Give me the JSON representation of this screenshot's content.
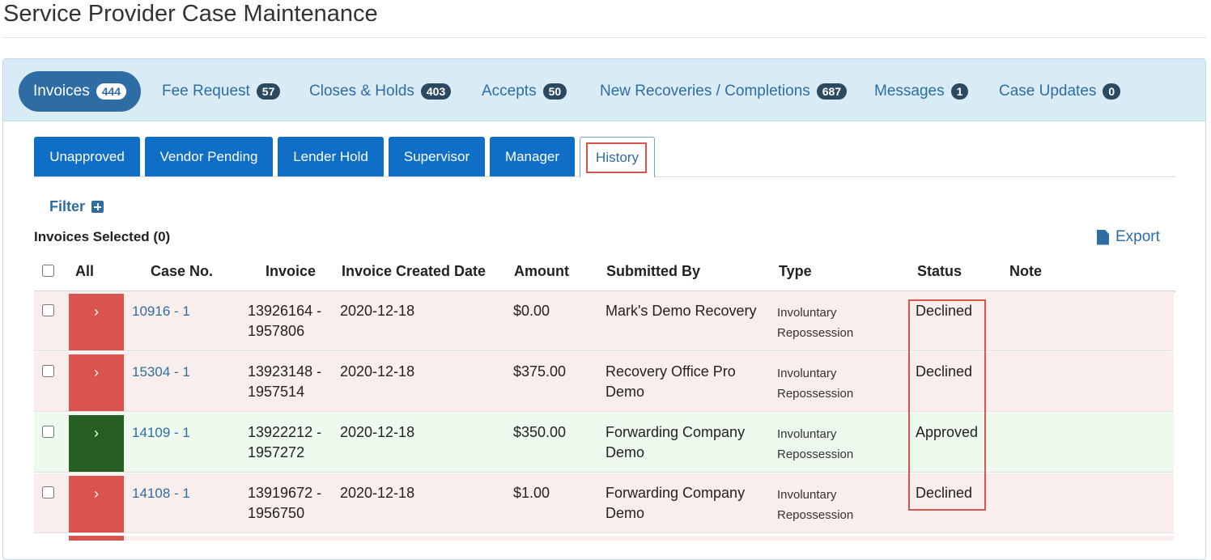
{
  "page_title": "Service Provider Case Maintenance",
  "main_tabs": [
    {
      "label": "Invoices",
      "count": "444"
    },
    {
      "label": "Fee Request",
      "count": "57"
    },
    {
      "label": "Closes & Holds",
      "count": "403"
    },
    {
      "label": "Accepts",
      "count": "50"
    },
    {
      "label": "New Recoveries / Completions",
      "count": "687"
    },
    {
      "label": "Messages",
      "count": "1"
    },
    {
      "label": "Case Updates",
      "count": "0"
    }
  ],
  "sub_tabs": [
    "Unapproved",
    "Vendor Pending",
    "Lender Hold",
    "Supervisor",
    "Manager",
    "History"
  ],
  "filter_label": "Filter",
  "selected_label": "Invoices Selected (0)",
  "export_label": "Export",
  "columns": [
    "All",
    "Case No.",
    "Invoice",
    "Invoice Created Date",
    "Amount",
    "Submitted By",
    "Type",
    "Status",
    "Note"
  ],
  "rows": [
    {
      "case_no": "10916 - 1",
      "invoice_1": "13926164 -",
      "invoice_2": "1957806",
      "date": "2020-12-18",
      "amount": "$0.00",
      "submitted_1": "Mark's Demo Recovery",
      "submitted_2": "",
      "type_1": "Involuntary",
      "type_2": "Repossession",
      "status": "Declined",
      "note": ""
    },
    {
      "case_no": "15304 - 1",
      "invoice_1": "13923148 -",
      "invoice_2": "1957514",
      "date": "2020-12-18",
      "amount": "$375.00",
      "submitted_1": "Recovery Office Pro",
      "submitted_2": "Demo",
      "type_1": "Involuntary",
      "type_2": "Repossession",
      "status": "Declined",
      "note": ""
    },
    {
      "case_no": "14109 - 1",
      "invoice_1": "13922212 -",
      "invoice_2": "1957272",
      "date": "2020-12-18",
      "amount": "$350.00",
      "submitted_1": "Forwarding Company",
      "submitted_2": "Demo",
      "type_1": "Involuntary",
      "type_2": "Repossession",
      "status": "Approved",
      "note": ""
    },
    {
      "case_no": "14108 - 1",
      "invoice_1": "13919672 -",
      "invoice_2": "1956750",
      "date": "2020-12-18",
      "amount": "$1.00",
      "submitted_1": "Forwarding Company",
      "submitted_2": "Demo",
      "type_1": "Involuntary",
      "type_2": "Repossession",
      "status": "Declined",
      "note": ""
    }
  ],
  "expander_glyph": "›",
  "icons": {
    "filter": "plus-square-icon",
    "export": "file-icon",
    "expander": "chevron-right-icon"
  },
  "colors": {
    "accent": "#2e6da4",
    "declined": "#d9534f",
    "approved": "#265e23",
    "tab": "#0f6fc6",
    "highlight": "#d9534f"
  }
}
